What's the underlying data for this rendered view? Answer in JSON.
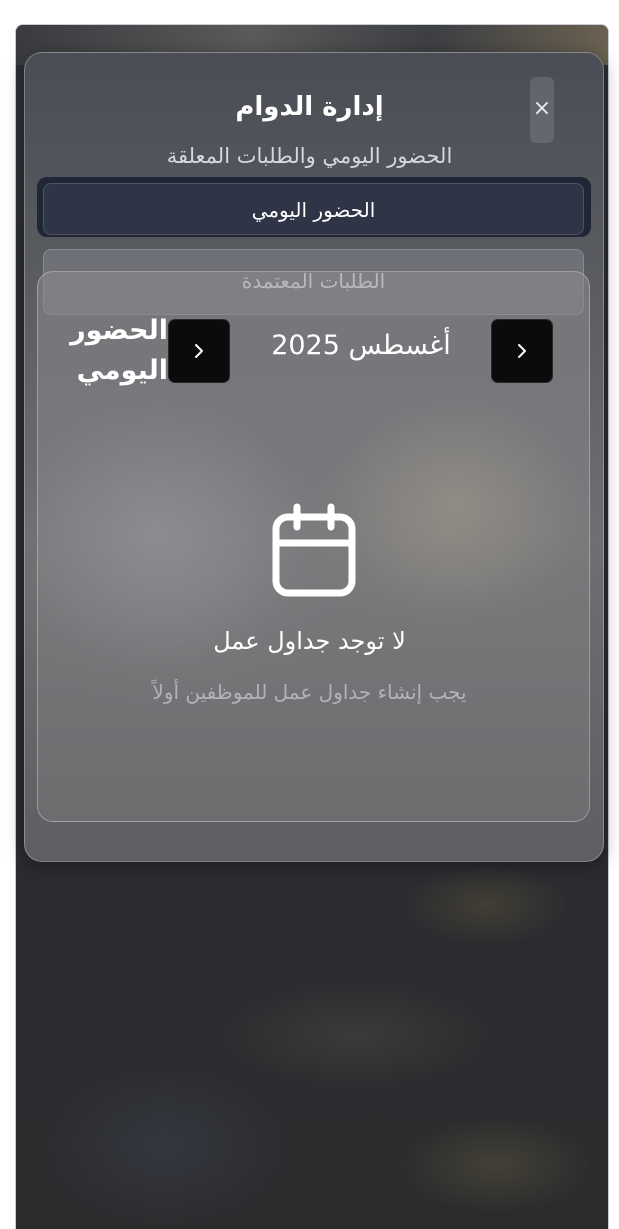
{
  "modal": {
    "title": "إدارة الدوام",
    "subtitle": "الحضور اليومي والطلبات المعلقة",
    "close_label": "×"
  },
  "tabs": [
    {
      "label": "الحضور اليومي"
    },
    {
      "label": "الطلبات المعتمدة"
    }
  ],
  "section": {
    "title": "الحضور اليومي",
    "month": "أغسطس 2025"
  },
  "empty_state": {
    "title": "لا توجد جداول عمل",
    "hint": "يجب إنشاء جداول عمل للموظفين أولاً",
    "icon": "calendar-icon"
  },
  "colors": {
    "tab_active": "#2f3446",
    "nav_button": "#0b0b0c",
    "text_primary": "#ffffff",
    "text_muted": "#b1b3b8"
  }
}
